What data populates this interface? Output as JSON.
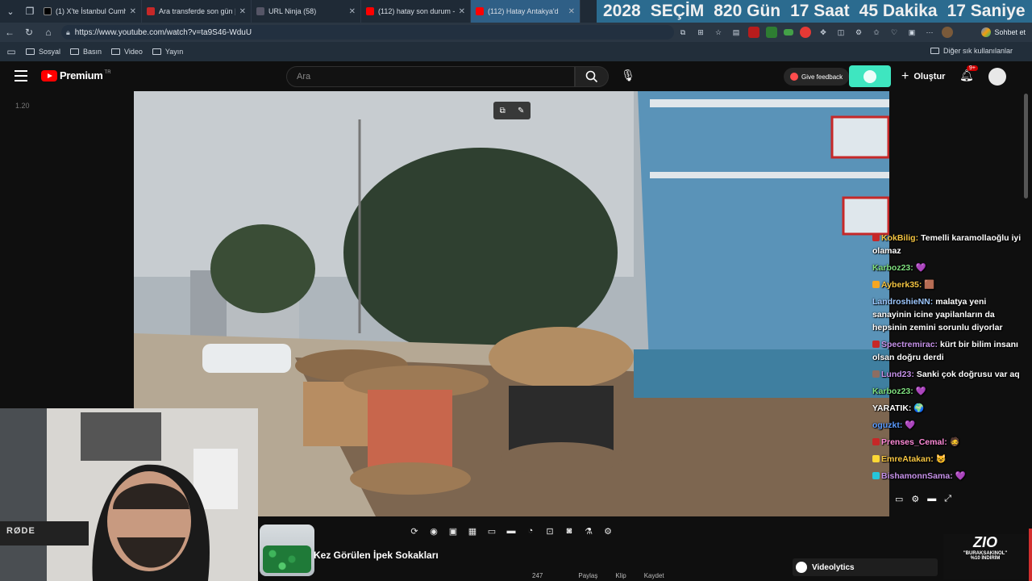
{
  "browser": {
    "tabs": [
      {
        "title": "(1) X'te İstanbul Cumhuriye",
        "favicon": "x-icon",
        "active": false
      },
      {
        "title": "Ara transferde son gün | CA",
        "favicon": "b-icon",
        "active": false
      },
      {
        "title": "URL Ninja (58)",
        "favicon": "url-icon",
        "active": false
      },
      {
        "title": "(112) hatay son durum - Yo",
        "favicon": "youtube-icon",
        "active": false
      },
      {
        "title": "(112) Hatay Antakya'd",
        "favicon": "youtube-icon",
        "active": true
      }
    ],
    "url": "https://www.youtube.com/watch?v=ta9S46-WduU",
    "chat_button_label": "Sohbet et",
    "bookmarks": [
      {
        "label": "Sosyal"
      },
      {
        "label": "Basın"
      },
      {
        "label": "Video"
      },
      {
        "label": "Yayın"
      }
    ],
    "other_bookmarks_label": "Diğer sık kullanılanlar"
  },
  "election_banner": {
    "year": "2028",
    "label": "SEÇİM",
    "days": "820 Gün",
    "hours": "17 Saat",
    "minutes": "45 Dakika",
    "seconds": "17 Saniye"
  },
  "youtube": {
    "logo_text": "Premium",
    "logo_region": "TR",
    "search_placeholder": "Ara",
    "feedback_label": "Give feedback",
    "create_label": "Oluştur",
    "notification_count": "9+",
    "playback_speed": "1.20",
    "video_title_partial": "Kez Görülen İpek Sokakları",
    "videolytics_label": "Videolytics",
    "actions": [
      "247",
      "",
      "Paylaş",
      "Klip",
      "Kaydet"
    ]
  },
  "chat": [
    {
      "user": "KokBilig:",
      "text": "Temelli karamollaoğlu iyi olamaz",
      "user_color": "#f5c542"
    },
    {
      "user": "Karboz23:",
      "text": "💜",
      "user_color": "#7fe07f"
    },
    {
      "user": "Ayberk35:",
      "text": "🟫",
      "user_color": "#f5c542"
    },
    {
      "user": "LandroshieNN:",
      "text": "malatya yeni sanayinin icine yapilanların da hepsinin zemini sorunlu diyorlar",
      "user_color": "#9ec8ff"
    },
    {
      "user": "Spectremirac:",
      "text": "kürt bir bilim insanı olsan doğru derdi",
      "user_color": "#c792ea"
    },
    {
      "user": "Lund23:",
      "text": "Sanki çok doğrusu var aq",
      "user_color": "#c792ea"
    },
    {
      "user": "Karboz23:",
      "text": "💜",
      "user_color": "#7fe07f"
    },
    {
      "user": "YARATIK:",
      "text": "🌍",
      "user_color": "#ffffff"
    },
    {
      "user": "oguzkt:",
      "text": "💜",
      "user_color": "#5a9bff"
    },
    {
      "user": "Prenses_Cemal:",
      "text": "🧔",
      "user_color": "#ff8ad8"
    },
    {
      "user": "EmreAtakan:",
      "text": "😺",
      "user_color": "#f5c542"
    },
    {
      "user": "BishamonnSama:",
      "text": "💜",
      "user_color": "#c792ea"
    }
  ],
  "promo": {
    "brand": "ZIO",
    "line1": "\"BURAKSAKINOL\"",
    "line2": "%10 İNDİRİM"
  },
  "webcam_mic_label": "RØDE"
}
